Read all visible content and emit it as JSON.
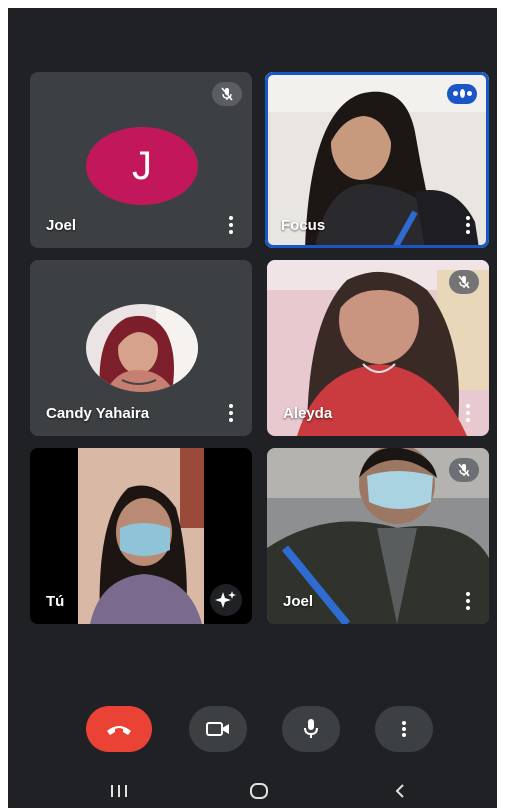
{
  "participants": [
    {
      "name": "Joel",
      "initial": "J",
      "avatar_color": "#c2185b",
      "muted": true,
      "video": false
    },
    {
      "name": "Focus",
      "muted": false,
      "speaking": true,
      "video": true,
      "highlighted": true
    },
    {
      "name": "Candy Yahaira",
      "muted": false,
      "video": false,
      "has_photo_avatar": true
    },
    {
      "name": "Aleyda",
      "muted": true,
      "video": true
    },
    {
      "name": "Tú",
      "muted": false,
      "video": true,
      "self": true
    },
    {
      "name": "Joel",
      "muted": true,
      "video": true
    }
  ],
  "controls": [
    {
      "icon": "end-call-icon",
      "color": "#ea4335"
    },
    {
      "icon": "camera-icon"
    },
    {
      "icon": "microphone-icon"
    },
    {
      "icon": "more-options-icon"
    }
  ],
  "colors": {
    "background": "#202124",
    "tile": "#3c4043",
    "accent": "#1a56c8",
    "end_call": "#ea4335"
  },
  "navbar": [
    "recent-apps-icon",
    "home-icon",
    "back-icon"
  ]
}
